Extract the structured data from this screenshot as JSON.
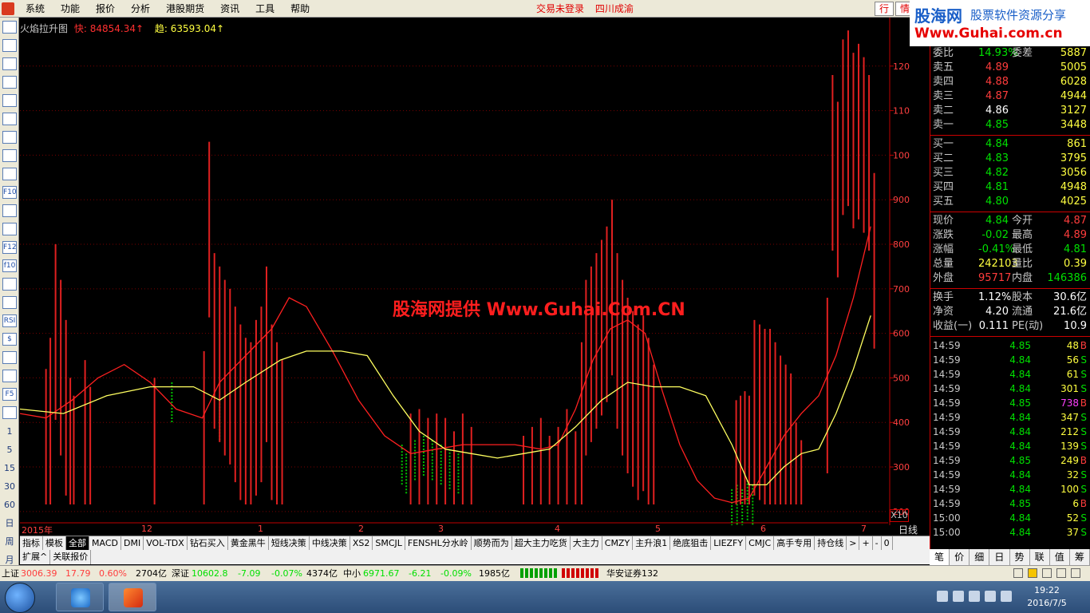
{
  "menu": {
    "items": [
      "系统",
      "功能",
      "报价",
      "分析",
      "港股期货",
      "资讯",
      "工具",
      "帮助"
    ],
    "status": [
      "交易未登录",
      "四川成渝"
    ],
    "hq_tabs": [
      "行",
      "情"
    ]
  },
  "logo": {
    "brand": "股海网",
    "slogan": "股票软件资源分享",
    "url": "Www.Guhai.com.cn"
  },
  "chart": {
    "title": "火焰拉升图",
    "fast_label": "快: 84854.34↑",
    "trend_label": "趋: 63593.04↑",
    "watermark": "股海网提供 Www.Guhai.Com.CN",
    "x10": "X10",
    "period_label": "日线",
    "x_labels": [
      "2015年",
      "12",
      "1",
      "2",
      "3",
      "4",
      "5",
      "6",
      "7"
    ]
  },
  "chart_data": {
    "type": "bar",
    "y_unit": "X10",
    "ylim": [
      1800,
      13000
    ],
    "y_ticks": [
      2000,
      3000,
      4000,
      5000,
      6000,
      7000,
      8000,
      9000,
      10000,
      11000,
      12000
    ],
    "red_bars": [
      [
        0.03,
        5200
      ],
      [
        0.035,
        5900
      ],
      [
        0.041,
        8000
      ],
      [
        0.047,
        7200
      ],
      [
        0.053,
        6300
      ],
      [
        0.058,
        5000
      ],
      [
        0.062,
        4600
      ],
      [
        0.075,
        5400
      ],
      [
        0.081,
        4800
      ],
      [
        0.155,
        5000
      ],
      [
        0.212,
        5600
      ],
      [
        0.218,
        10300
      ],
      [
        0.224,
        7800
      ],
      [
        0.23,
        7500
      ],
      [
        0.236,
        7200
      ],
      [
        0.242,
        7000
      ],
      [
        0.248,
        6600
      ],
      [
        0.254,
        6200
      ],
      [
        0.26,
        5900
      ],
      [
        0.266,
        5800
      ],
      [
        0.272,
        6300
      ],
      [
        0.278,
        6600
      ],
      [
        0.284,
        7500
      ],
      [
        0.29,
        6200
      ],
      [
        0.296,
        5800
      ],
      [
        0.302,
        5400
      ],
      [
        0.45,
        4200
      ],
      [
        0.46,
        4300
      ],
      [
        0.47,
        4100
      ],
      [
        0.48,
        4200
      ],
      [
        0.49,
        4100
      ],
      [
        0.5,
        3800
      ],
      [
        0.51,
        4200
      ],
      [
        0.52,
        3900
      ],
      [
        0.58,
        3700
      ],
      [
        0.59,
        3900
      ],
      [
        0.6,
        4100
      ],
      [
        0.61,
        3700
      ],
      [
        0.62,
        3900
      ],
      [
        0.63,
        4300
      ],
      [
        0.64,
        3800
      ],
      [
        0.647,
        5800
      ],
      [
        0.652,
        7200
      ],
      [
        0.658,
        7500
      ],
      [
        0.664,
        7800
      ],
      [
        0.67,
        8100
      ],
      [
        0.676,
        8400
      ],
      [
        0.682,
        9000
      ],
      [
        0.688,
        7800
      ],
      [
        0.694,
        7200
      ],
      [
        0.7,
        6800
      ],
      [
        0.706,
        6500
      ],
      [
        0.712,
        6200
      ],
      [
        0.718,
        6400
      ],
      [
        0.724,
        5900
      ],
      [
        0.73,
        5300
      ],
      [
        0.825,
        4500
      ],
      [
        0.83,
        4600
      ],
      [
        0.835,
        4700
      ],
      [
        0.84,
        4600
      ],
      [
        0.846,
        6300
      ],
      [
        0.852,
        6200
      ],
      [
        0.858,
        6100
      ],
      [
        0.864,
        6100
      ],
      [
        0.87,
        5800
      ],
      [
        0.876,
        5500
      ],
      [
        0.882,
        5300
      ],
      [
        0.888,
        5100
      ],
      [
        0.894,
        4000
      ],
      [
        0.9,
        3600
      ],
      [
        0.93,
        6800
      ],
      [
        0.936,
        11800
      ],
      [
        0.942,
        11200
      ],
      [
        0.948,
        12600
      ],
      [
        0.954,
        12800
      ],
      [
        0.96,
        12300
      ],
      [
        0.966,
        12500
      ],
      [
        0.972,
        12200
      ],
      [
        0.978,
        11800
      ],
      [
        0.984,
        9600
      ]
    ],
    "green_bars": [
      [
        0.175,
        4900
      ],
      [
        0.23,
        4500
      ],
      [
        0.44,
        3500
      ],
      [
        0.445,
        3300
      ],
      [
        0.455,
        3600
      ],
      [
        0.465,
        3700
      ],
      [
        0.475,
        3600
      ],
      [
        0.485,
        3500
      ],
      [
        0.495,
        3400
      ],
      [
        0.505,
        3300
      ],
      [
        0.82,
        2500
      ],
      [
        0.826,
        2600
      ],
      [
        0.832,
        2500
      ],
      [
        0.838,
        2700
      ],
      [
        0.844,
        2600
      ]
    ],
    "series": [
      {
        "points": [
          [
            0.0,
            4200
          ],
          [
            0.03,
            4100
          ],
          [
            0.06,
            4500
          ],
          [
            0.09,
            5000
          ],
          [
            0.12,
            5300
          ],
          [
            0.15,
            4900
          ],
          [
            0.18,
            4300
          ],
          [
            0.21,
            4100
          ],
          [
            0.23,
            4900
          ],
          [
            0.26,
            5500
          ],
          [
            0.29,
            6100
          ],
          [
            0.31,
            6800
          ],
          [
            0.33,
            6600
          ],
          [
            0.36,
            5600
          ],
          [
            0.39,
            4500
          ],
          [
            0.42,
            3700
          ],
          [
            0.45,
            3300
          ],
          [
            0.48,
            3400
          ],
          [
            0.51,
            3500
          ],
          [
            0.54,
            3500
          ],
          [
            0.57,
            3500
          ],
          [
            0.6,
            3400
          ],
          [
            0.62,
            3500
          ],
          [
            0.64,
            4300
          ],
          [
            0.66,
            5400
          ],
          [
            0.68,
            6100
          ],
          [
            0.7,
            6300
          ],
          [
            0.72,
            6000
          ],
          [
            0.74,
            4700
          ],
          [
            0.76,
            3500
          ],
          [
            0.78,
            2700
          ],
          [
            0.8,
            2300
          ],
          [
            0.82,
            2200
          ],
          [
            0.84,
            2300
          ],
          [
            0.86,
            3000
          ],
          [
            0.88,
            3700
          ],
          [
            0.9,
            4200
          ],
          [
            0.92,
            4600
          ],
          [
            0.94,
            5500
          ],
          [
            0.96,
            6800
          ],
          [
            0.98,
            8400
          ]
        ]
      },
      {
        "points": [
          [
            0.0,
            4300
          ],
          [
            0.05,
            4200
          ],
          [
            0.1,
            4600
          ],
          [
            0.15,
            4800
          ],
          [
            0.2,
            4800
          ],
          [
            0.23,
            4500
          ],
          [
            0.26,
            4900
          ],
          [
            0.3,
            5400
          ],
          [
            0.33,
            5600
          ],
          [
            0.37,
            5600
          ],
          [
            0.4,
            5500
          ],
          [
            0.43,
            4600
          ],
          [
            0.46,
            3800
          ],
          [
            0.49,
            3400
          ],
          [
            0.52,
            3300
          ],
          [
            0.55,
            3200
          ],
          [
            0.58,
            3300
          ],
          [
            0.61,
            3400
          ],
          [
            0.64,
            3900
          ],
          [
            0.67,
            4500
          ],
          [
            0.7,
            4900
          ],
          [
            0.73,
            4800
          ],
          [
            0.76,
            4800
          ],
          [
            0.79,
            4600
          ],
          [
            0.82,
            3500
          ],
          [
            0.84,
            2600
          ],
          [
            0.86,
            2600
          ],
          [
            0.88,
            3000
          ],
          [
            0.9,
            3300
          ],
          [
            0.92,
            3400
          ],
          [
            0.94,
            4200
          ],
          [
            0.96,
            5200
          ],
          [
            0.98,
            6400
          ]
        ]
      }
    ]
  },
  "quote": {
    "header": [
      "委比",
      "14.93%",
      "委差",
      "5887"
    ],
    "sell": [
      {
        "label": "卖五",
        "price": "4.89",
        "vol": "5005",
        "cls": "red"
      },
      {
        "label": "卖四",
        "price": "4.88",
        "vol": "6028",
        "cls": "red"
      },
      {
        "label": "卖三",
        "price": "4.87",
        "vol": "4944",
        "cls": "red"
      },
      {
        "label": "卖二",
        "price": "4.86",
        "vol": "3127",
        "cls": "white"
      },
      {
        "label": "卖一",
        "price": "4.85",
        "vol": "3448",
        "cls": "green"
      }
    ],
    "buy": [
      {
        "label": "买一",
        "price": "4.84",
        "vol": "861",
        "cls": "green"
      },
      {
        "label": "买二",
        "price": "4.83",
        "vol": "3795",
        "cls": "green"
      },
      {
        "label": "买三",
        "price": "4.82",
        "vol": "3056",
        "cls": "green"
      },
      {
        "label": "买四",
        "price": "4.81",
        "vol": "4948",
        "cls": "green"
      },
      {
        "label": "买五",
        "price": "4.80",
        "vol": "4025",
        "cls": "green"
      }
    ],
    "stats": [
      {
        "l1": "现价",
        "v1": "4.84",
        "c1": "green",
        "l2": "今开",
        "v2": "4.87",
        "c2": "red"
      },
      {
        "l1": "涨跌",
        "v1": "-0.02",
        "c1": "green",
        "l2": "最高",
        "v2": "4.89",
        "c2": "red"
      },
      {
        "l1": "涨幅",
        "v1": "-0.41%",
        "c1": "green",
        "l2": "最低",
        "v2": "4.81",
        "c2": "green"
      },
      {
        "l1": "总量",
        "v1": "242103",
        "c1": "yellow",
        "l2": "量比",
        "v2": "0.39",
        "c2": "yellow"
      },
      {
        "l1": "外盘",
        "v1": "95717",
        "c1": "red",
        "l2": "内盘",
        "v2": "146386",
        "c2": "green"
      }
    ],
    "fundamentals": [
      {
        "l1": "换手",
        "v1": "1.12%",
        "l2": "股本",
        "v2": "30.6亿"
      },
      {
        "l1": "净资",
        "v1": "4.20",
        "l2": "流通",
        "v2": "21.6亿"
      },
      {
        "l1": "收益(一)",
        "v1": "0.111",
        "l2": "PE(动)",
        "v2": "10.9"
      }
    ],
    "ticks": [
      {
        "t": "14:59",
        "p": "4.85",
        "v": "48",
        "s": "B",
        "pc": "green",
        "vc": "yellow",
        "sc": "red"
      },
      {
        "t": "14:59",
        "p": "4.84",
        "v": "56",
        "s": "S",
        "pc": "green",
        "vc": "yellow",
        "sc": "green"
      },
      {
        "t": "14:59",
        "p": "4.84",
        "v": "61",
        "s": "S",
        "pc": "green",
        "vc": "yellow",
        "sc": "green"
      },
      {
        "t": "14:59",
        "p": "4.84",
        "v": "301",
        "s": "S",
        "pc": "green",
        "vc": "yellow",
        "sc": "green"
      },
      {
        "t": "14:59",
        "p": "4.85",
        "v": "738",
        "s": "B",
        "pc": "green",
        "vc": "purple",
        "sc": "red"
      },
      {
        "t": "14:59",
        "p": "4.84",
        "v": "347",
        "s": "S",
        "pc": "green",
        "vc": "yellow",
        "sc": "green"
      },
      {
        "t": "14:59",
        "p": "4.84",
        "v": "212",
        "s": "S",
        "pc": "green",
        "vc": "yellow",
        "sc": "green"
      },
      {
        "t": "14:59",
        "p": "4.84",
        "v": "139",
        "s": "S",
        "pc": "green",
        "vc": "yellow",
        "sc": "green"
      },
      {
        "t": "14:59",
        "p": "4.85",
        "v": "249",
        "s": "B",
        "pc": "green",
        "vc": "yellow",
        "sc": "red"
      },
      {
        "t": "14:59",
        "p": "4.84",
        "v": "32",
        "s": "S",
        "pc": "green",
        "vc": "yellow",
        "sc": "green"
      },
      {
        "t": "14:59",
        "p": "4.84",
        "v": "100",
        "s": "S",
        "pc": "green",
        "vc": "yellow",
        "sc": "green"
      },
      {
        "t": "14:59",
        "p": "4.85",
        "v": "6",
        "s": "B",
        "pc": "green",
        "vc": "yellow",
        "sc": "red"
      },
      {
        "t": "15:00",
        "p": "4.84",
        "v": "52",
        "s": "S",
        "pc": "green",
        "vc": "yellow",
        "sc": "green"
      },
      {
        "t": "15:00",
        "p": "4.84",
        "v": "37",
        "s": "S",
        "pc": "green",
        "vc": "yellow",
        "sc": "green"
      }
    ]
  },
  "right_tabs": [
    "笔",
    "价",
    "细",
    "日",
    "势",
    "联",
    "值",
    "筹"
  ],
  "left_tools": {
    "icons": [
      "back-icon",
      "up-arrow-icon",
      "down-arrow-icon",
      "tile-icon",
      "grid-icon",
      "line-chart-icon",
      "kline-icon",
      "list-icon",
      "doc-icon",
      "f10-icon",
      "lock-icon",
      "window-icon",
      "f12-icon",
      "f10b-icon",
      "circle-icon",
      "wave-icon",
      "rsi-icon",
      "dollar-icon",
      "move-icon",
      "pen-icon",
      "f5-icon",
      "switch-icon"
    ],
    "icon_text": [
      "",
      "",
      "",
      "",
      "",
      "",
      "",
      "",
      "",
      "F10",
      "",
      "",
      "F12",
      "f10",
      "",
      "",
      "RSI",
      "$",
      "",
      "",
      "F5",
      ""
    ],
    "periods": [
      "1",
      "5",
      "15",
      "30",
      "60",
      "日",
      "周",
      "月"
    ]
  },
  "indicator_tabs": [
    "指标",
    "模板",
    "全部",
    "MACD",
    "DMI",
    "VOL-TDX",
    "钻石买入",
    "黄金黑牛",
    "短线决策",
    "中线决策",
    "XS2",
    "SMCJL",
    "FENSHL分水岭",
    "顺势而为",
    "超大主力吃货",
    "大主力",
    "CMZY",
    "主升浪1",
    "绝底狙击",
    "LIEZFY",
    "CMJC",
    "高手专用",
    "持仓线",
    ">",
    "+",
    "-",
    "0"
  ],
  "expand_tabs": [
    "扩展^",
    "关联报价"
  ],
  "statusbar": {
    "sh_label": "上证",
    "sh_index": "3006.39",
    "sh_change": "17.79",
    "sh_pct": "0.60%",
    "sh_amount": "2704亿",
    "sz_label": "深证",
    "sz_index": "10602.8",
    "sz_change": "-7.09",
    "sz_pct": "-0.07%",
    "sz_amount": "4374亿",
    "zx_label": "中小",
    "zx_index": "6971.67",
    "zx_change": "-6.21",
    "zx_pct": "-0.09%",
    "zx_amount": "1985亿",
    "broker": "华安证券132"
  },
  "clock": {
    "time": "19:22",
    "date": "2016/7/5"
  }
}
